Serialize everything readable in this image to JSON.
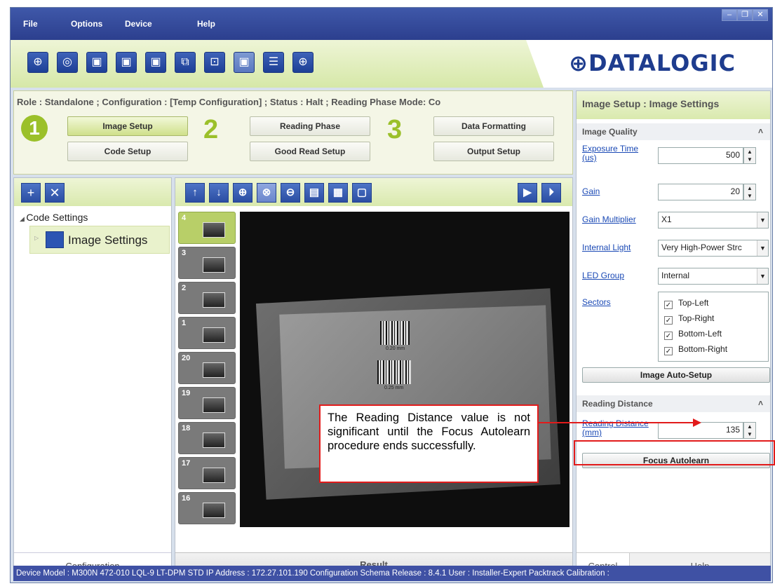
{
  "menu": [
    "File",
    "Options",
    "Device",
    "Help"
  ],
  "logo": "DATALOGIC",
  "role_line": "Role :  Standalone ;  Configuration :  [Temp Configuration] ;  Status :  Halt ;  Reading Phase Mode: Co",
  "steps": {
    "n1": "1",
    "n2": "2",
    "n3": "3",
    "image_setup": "Image Setup",
    "code_setup": "Code Setup",
    "reading_phase": "Reading Phase",
    "good_read_setup": "Good Read Setup",
    "data_formatting": "Data Formatting",
    "output_setup": "Output Setup"
  },
  "tree": {
    "root": "Code Settings",
    "child": "Image Settings"
  },
  "left_footer": "Configuration",
  "center_footer": "Result",
  "thumbnails": [
    "4",
    "3",
    "2",
    "1",
    "20",
    "19",
    "18",
    "17",
    "16"
  ],
  "viewer_labels": {
    "m1": "0.20 mm",
    "m2": "0.25 mm"
  },
  "right_panel": {
    "title": "Image Setup :  Image Settings",
    "image_quality": "Image Quality",
    "exposure_label": "Exposure Time (us)",
    "exposure_value": "500",
    "gain_label": "Gain",
    "gain_value": "20",
    "gain_mult_label": "Gain Multiplier",
    "gain_mult_value": "X1",
    "internal_light_label": "Internal Light",
    "internal_light_value": "Very High-Power Strc",
    "led_group_label": "LED Group",
    "led_group_value": "Internal",
    "sectors_label": "Sectors",
    "sectors": [
      "Top-Left",
      "Top-Right",
      "Bottom-Left",
      "Bottom-Right"
    ],
    "auto_setup": "Image Auto-Setup",
    "reading_distance_head": "Reading Distance",
    "reading_distance_label": "Reading Distance (mm)",
    "reading_distance_value": "135",
    "focus_autolearn": "Focus Autolearn",
    "tab_control": "Control",
    "tab_help": "Help"
  },
  "status_bar": "Device Model : M300N  472-010  LQL-9 LT-DPM STD   IP Address :  172.27.101.190   Configuration Schema Release :  8.4.1   User : Installer-Expert   Packtrack Calibration :",
  "callout": "The Reading Distance value is not significant until the Focus Autolearn procedure ends successfully.",
  "colors": {
    "accent_green": "#9bc02a",
    "brand_blue": "#1e3c8e",
    "callout_red": "#e21b1b"
  }
}
